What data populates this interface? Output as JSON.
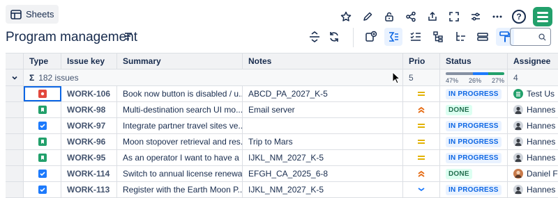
{
  "header": {
    "sheets_label": "Sheets",
    "page_title": "Program management"
  },
  "top_icons": [
    "star-icon",
    "edit-icon",
    "lock-icon",
    "share-icon",
    "export-icon",
    "fullscreen-icon",
    "settings-sliders-icon",
    "more-icon",
    "help-icon"
  ],
  "help_glyph": "?",
  "search": {
    "placeholder": ""
  },
  "columns": [
    {
      "key": "type",
      "label": "Type"
    },
    {
      "key": "issue_key",
      "label": "Issue key"
    },
    {
      "key": "summary",
      "label": "Summary"
    },
    {
      "key": "notes",
      "label": "Notes"
    },
    {
      "key": "prio",
      "label": "Prio"
    },
    {
      "key": "status",
      "label": "Status"
    },
    {
      "key": "assignee",
      "label": "Assignee"
    }
  ],
  "group": {
    "sigma": "Σ",
    "issue_count": "182 issues",
    "prio_value": "5",
    "assignee_value": "4",
    "status_distribution": [
      {
        "label": "47%",
        "color": "#8590a2",
        "fraction": 0.47
      },
      {
        "label": "26%",
        "color": "#1d7afc",
        "fraction": 0.26
      },
      {
        "label": "27%",
        "color": "#22a06b",
        "fraction": 0.27
      }
    ]
  },
  "rows": [
    {
      "type": "bug",
      "key": "WORK-106",
      "summary": "Book now button is disabled / u...",
      "notes": "ABCD_PA_2027_K-5",
      "prio": "medium",
      "status": "IN PROGRESS",
      "assignee": "Test Us",
      "avatar": "green-logo"
    },
    {
      "type": "story",
      "key": "WORK-98",
      "summary": "Multi-destination search UI mo...",
      "notes": "Email server",
      "prio": "high",
      "status": "DONE",
      "assignee": "Hannes",
      "avatar": "person"
    },
    {
      "type": "task",
      "key": "WORK-97",
      "summary": "Integrate partner travel sites ve...",
      "notes": "",
      "prio": "medium",
      "status": "IN PROGRESS",
      "assignee": "Hannes",
      "avatar": "person"
    },
    {
      "type": "story",
      "key": "WORK-96",
      "summary": "Moon stopover retrieval and res...",
      "notes": "Trip to Mars",
      "prio": "medium",
      "status": "IN PROGRESS",
      "assignee": "Hannes",
      "avatar": "person"
    },
    {
      "type": "story",
      "key": "WORK-95",
      "summary": "As an operator I want to have a ...",
      "notes": "IJKL_NM_2027_K-5",
      "prio": "medium",
      "status": "IN PROGRESS",
      "assignee": "Hannes",
      "avatar": "person"
    },
    {
      "type": "task",
      "key": "WORK-114",
      "summary": "Switch to annual license renewal",
      "notes": "EFGH_CA_2025_6-8",
      "prio": "high",
      "status": "DONE",
      "assignee": "Daniel F",
      "avatar": "person-2"
    },
    {
      "type": "task",
      "key": "WORK-113",
      "summary": "Register with the Earth Moon P...",
      "notes": "IJKL_NM_2027_K-5",
      "prio": "low",
      "status": "IN PROGRESS",
      "assignee": "Hannes",
      "avatar": "person"
    }
  ],
  "colors": {
    "bug": "#e2483d",
    "story": "#22a06b",
    "task": "#1d7afc",
    "prio_medium": "#e2b203",
    "prio_high": "#e56910",
    "prio_low": "#1d7afc",
    "brand": "#22a06b"
  }
}
